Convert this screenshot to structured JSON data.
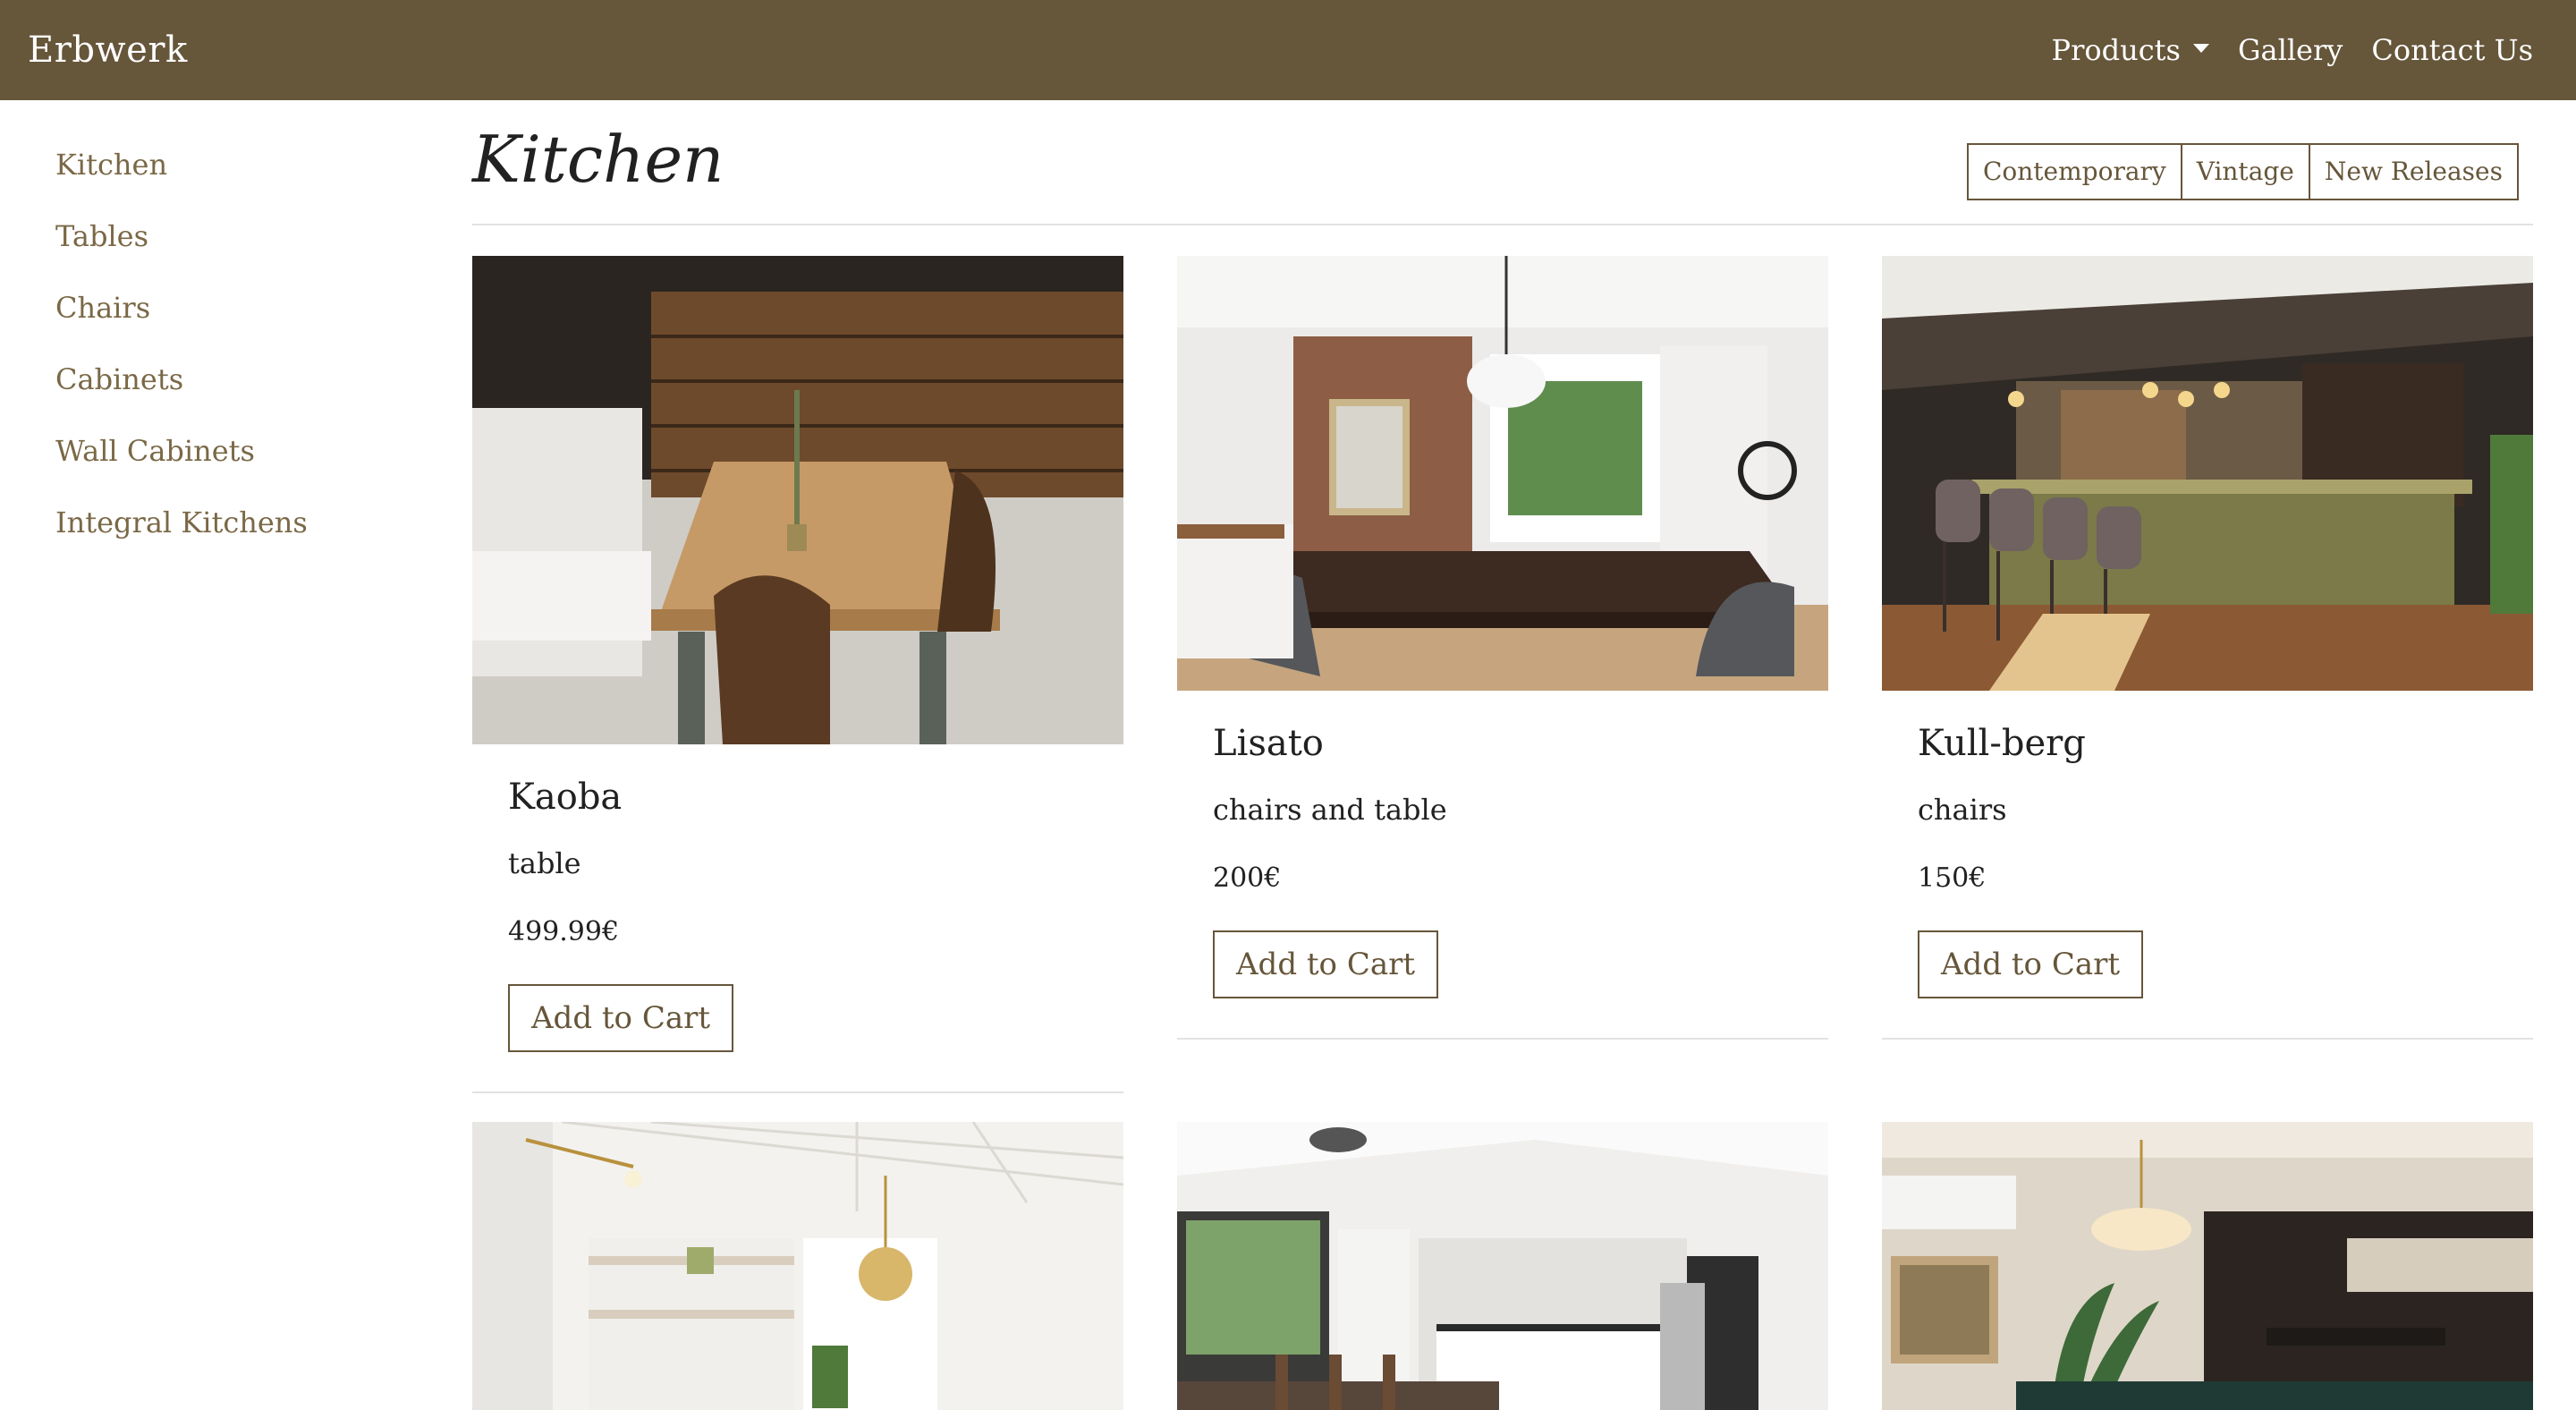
{
  "navbar": {
    "brand": "Erbwerk",
    "links": [
      {
        "label": "Products",
        "has_caret": true
      },
      {
        "label": "Gallery"
      },
      {
        "label": "Contact Us"
      }
    ]
  },
  "sidebar": {
    "items": [
      {
        "label": "Kitchen"
      },
      {
        "label": "Tables"
      },
      {
        "label": "Chairs"
      },
      {
        "label": "Cabinets"
      },
      {
        "label": "Wall Cabinets"
      },
      {
        "label": "Integral Kitchens"
      }
    ]
  },
  "main": {
    "title": "Kitchen",
    "filters": [
      "Contemporary",
      "Vintage",
      "New Releases"
    ],
    "products": [
      {
        "name": "Kaoba",
        "type": "table",
        "price": "499.99€",
        "button": "Add to Cart",
        "image": "rustic wooden dining table"
      },
      {
        "name": "Lisato",
        "type": "chairs and table",
        "price": "200€",
        "button": "Add to Cart",
        "image": "dining room with dark table"
      },
      {
        "name": "Kull-berg",
        "type": "chairs",
        "price": "150€",
        "button": "Add to Cart",
        "image": "bar with green counter and stools"
      },
      {
        "image": "white kitchen with brass pendant lights"
      },
      {
        "image": "open kitchen with dining table"
      },
      {
        "image": "dark kitchen with pendant lamp and plants"
      }
    ]
  },
  "colors": {
    "navbar_bg": "#66563a",
    "accent": "#7a6846",
    "divider": "#e2e2e2"
  }
}
